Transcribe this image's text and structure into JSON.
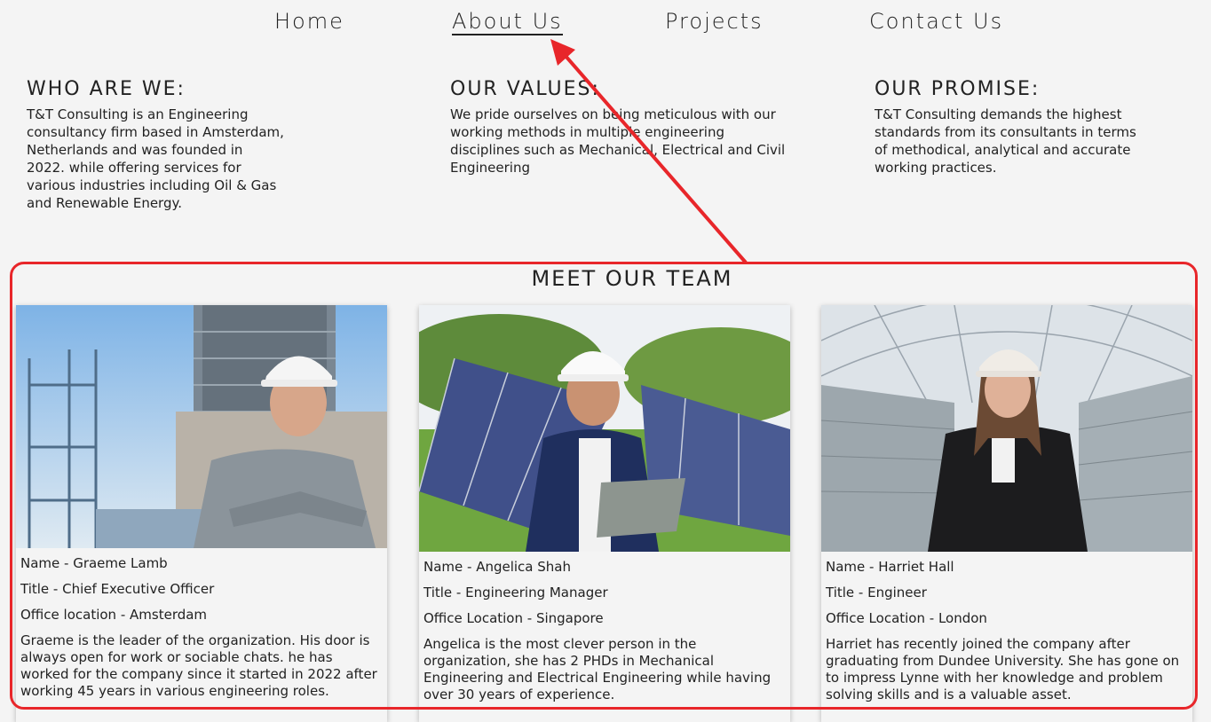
{
  "nav": {
    "home": "Home",
    "about": "About Us",
    "projects": "Projects",
    "contact": "Contact Us",
    "active": "about"
  },
  "sections": {
    "who": {
      "title": "WHO ARE WE:",
      "text": "T&T Consulting is an Engineering consultancy firm based in Amsterdam, Netherlands and was founded in 2022. while offering services for various industries including Oil & Gas and Renewable Energy."
    },
    "values": {
      "title": "OUR VALUES:",
      "text": "We pride ourselves on being meticulous with our working methods in multiple engineering disciplines such as Mechanical, Electrical and Civil Engineering"
    },
    "promise": {
      "title": "OUR PROMISE:",
      "text": "T&T Consulting demands the highest standards from its consultants in terms of methodical, analytical and accurate working practices."
    }
  },
  "team": {
    "title": "MEET OUR TEAM",
    "members": [
      {
        "name": "Name - Graeme Lamb",
        "title": "Title - Chief Executive Officer",
        "location": "Office location - Amsterdam",
        "bio": "Graeme is the leader of the organization. His door is always open for work or sociable chats. he has worked for the company since it started in 2022 after working 45 years in various engineering roles."
      },
      {
        "name": "Name - Angelica Shah",
        "title": "Title - Engineering Manager",
        "location": "Office Location - Singapore",
        "bio": "Angelica is the most clever person in the organization, she has 2 PHDs in Mechanical Engineering and Electrical Engineering while having over 30 years of experience."
      },
      {
        "name": "Name - Harriet Hall",
        "title": "Title - Engineer",
        "location": "Office Location - London",
        "bio": "Harriet has recently joined the company after graduating from Dundee University. She has gone on to impress Lynne with her knowledge and problem solving skills and is a valuable asset."
      }
    ]
  },
  "annotation": {
    "color": "#e8262a"
  }
}
